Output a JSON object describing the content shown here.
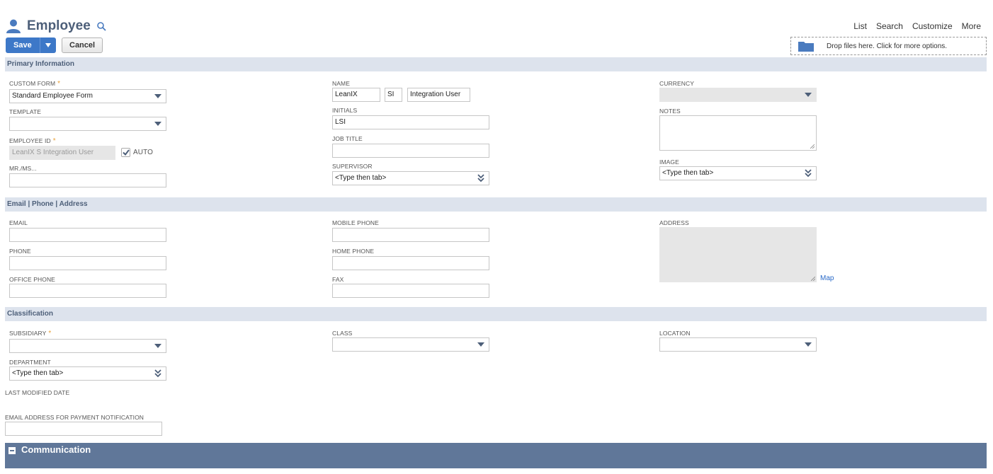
{
  "header": {
    "title": "Employee",
    "save_label": "Save",
    "cancel_label": "Cancel",
    "links": [
      "List",
      "Search",
      "Customize",
      "More"
    ],
    "drop_zone": "Drop files here. Click for more options."
  },
  "sections": {
    "primary": "Primary Information",
    "contact": "Email | Phone | Address",
    "classification": "Classification",
    "communication": "Communication"
  },
  "primary": {
    "custom_form_label": "CUSTOM FORM",
    "custom_form_value": "Standard Employee Form",
    "template_label": "TEMPLATE",
    "template_value": "",
    "employee_id_label": "EMPLOYEE ID",
    "employee_id_value": "LeanIX S Integration User",
    "auto_label": "AUTO",
    "auto_checked": true,
    "mrms_label": "MR./MS...",
    "mrms_value": "",
    "name_label": "NAME",
    "name_first": "LeanIX",
    "name_middle": "SI",
    "name_last": "Integration User",
    "initials_label": "INITIALS",
    "initials_value": "LSI",
    "job_title_label": "JOB TITLE",
    "job_title_value": "",
    "supervisor_label": "SUPERVISOR",
    "supervisor_value": "<Type then tab>",
    "currency_label": "CURRENCY",
    "currency_value": "",
    "notes_label": "NOTES",
    "image_label": "IMAGE",
    "image_value": "<Type then tab>"
  },
  "contact": {
    "email_label": "EMAIL",
    "phone_label": "PHONE",
    "office_phone_label": "OFFICE PHONE",
    "mobile_phone_label": "MOBILE PHONE",
    "home_phone_label": "HOME PHONE",
    "fax_label": "FAX",
    "address_label": "ADDRESS",
    "map_link": "Map"
  },
  "classification": {
    "subsidiary_label": "SUBSIDIARY",
    "class_label": "CLASS",
    "location_label": "LOCATION",
    "department_label": "DEPARTMENT",
    "department_value": "<Type then tab>",
    "last_modified_label": "LAST MODIFIED DATE",
    "payment_email_label": "EMAIL ADDRESS FOR PAYMENT NOTIFICATION"
  },
  "required_mark": "*",
  "colors": {
    "primary_button": "#3d78c8",
    "section_bar": "#dde3ed",
    "section_text": "#4d5f79",
    "required": "#e9a23b",
    "communication_bar": "#607799"
  }
}
